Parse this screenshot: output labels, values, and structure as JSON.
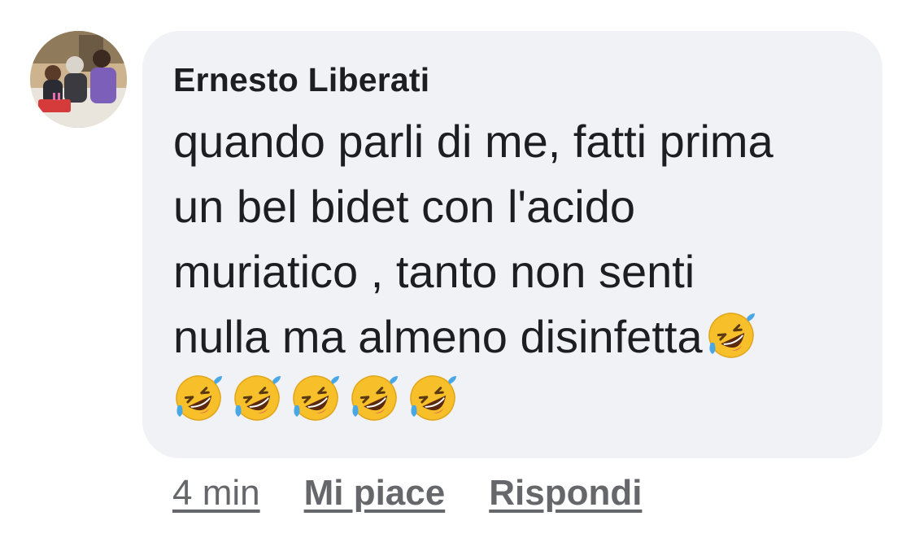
{
  "comment": {
    "author": "Ernesto Liberati",
    "lines": [
      "quando parli di me, fatti prima",
      "un bel bidet con l'acido",
      "muriatico , tanto non senti",
      "nulla ma almeno disinfetta"
    ],
    "emoji_name": "rolling-on-the-floor-laughing-emoji",
    "inline_emoji_count": 1,
    "trailing_emoji_count": 5
  },
  "actions": {
    "time": "4 min",
    "like": "Mi piace",
    "reply": "Rispondi"
  },
  "colors": {
    "bubble": "#f0f2f5",
    "text": "#1c1e21",
    "meta": "#65676b",
    "emoji_face": "#f7c02a",
    "tears": "#4aa7e6"
  }
}
